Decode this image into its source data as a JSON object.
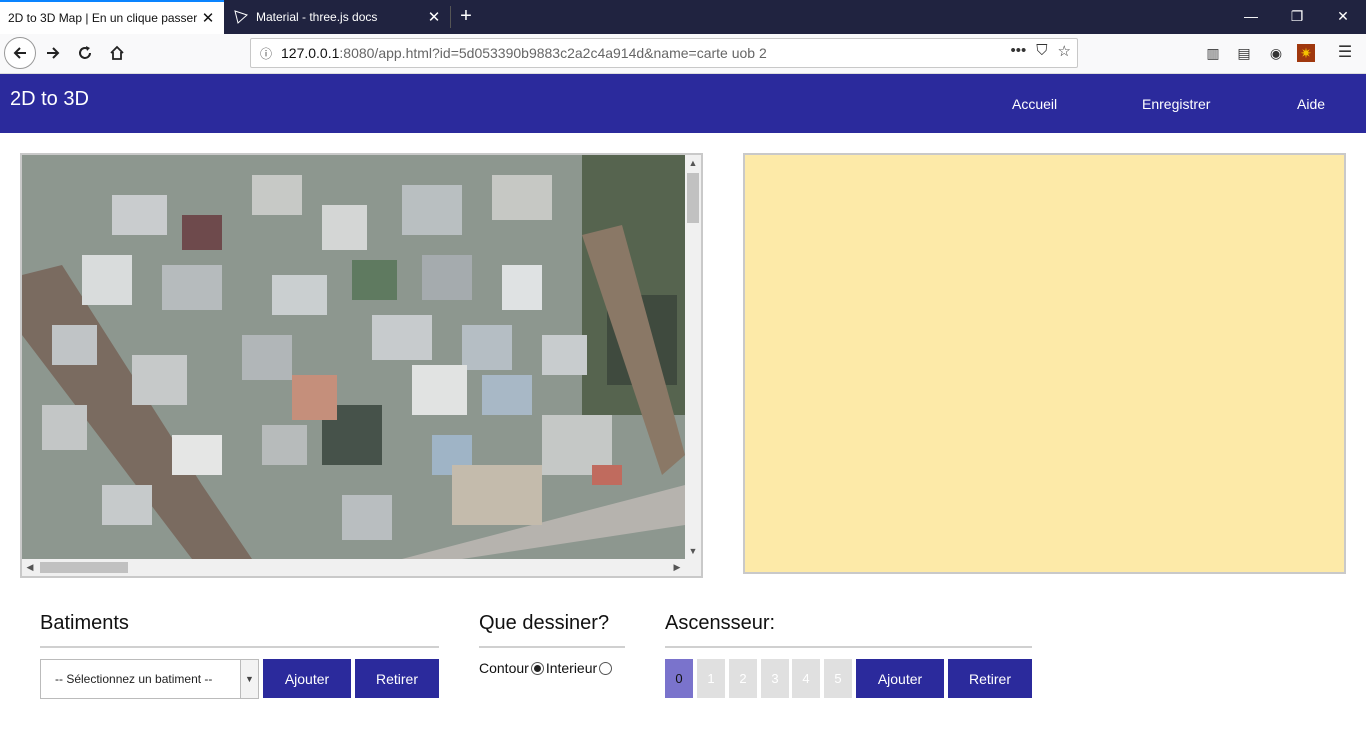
{
  "browser": {
    "tabs": [
      {
        "title": "2D to 3D Map | En un clique passer",
        "active": true
      },
      {
        "title": "Material - three.js docs",
        "active": false
      }
    ],
    "url": {
      "host": "127.0.0.1",
      "path": ":8080/app.html?id=5d053390b9883c2a2c4a914d&name=carte uob 2"
    }
  },
  "app": {
    "brand": "2D to 3D",
    "menu": [
      "Accueil",
      "Enregistrer",
      "Aide"
    ]
  },
  "viewer": {
    "background_color": "#fdeaa8"
  },
  "batiments": {
    "title": "Batiments",
    "select_value": "-- Sélectionnez un batiment --",
    "add_label": "Ajouter",
    "remove_label": "Retirer"
  },
  "dessin": {
    "title": "Que dessiner?",
    "options": [
      {
        "label": "Contour",
        "checked": true
      },
      {
        "label": "Interieur",
        "checked": false
      }
    ]
  },
  "ascenseur": {
    "title": "Ascensseur:",
    "floors": [
      "0",
      "1",
      "2",
      "3",
      "4",
      "5"
    ],
    "active_floor": "0",
    "add_label": "Ajouter",
    "remove_label": "Retirer"
  },
  "colors": {
    "brand": "#2b2a9c",
    "tab_bar": "#202340",
    "active_floor": "#7a73cc"
  }
}
